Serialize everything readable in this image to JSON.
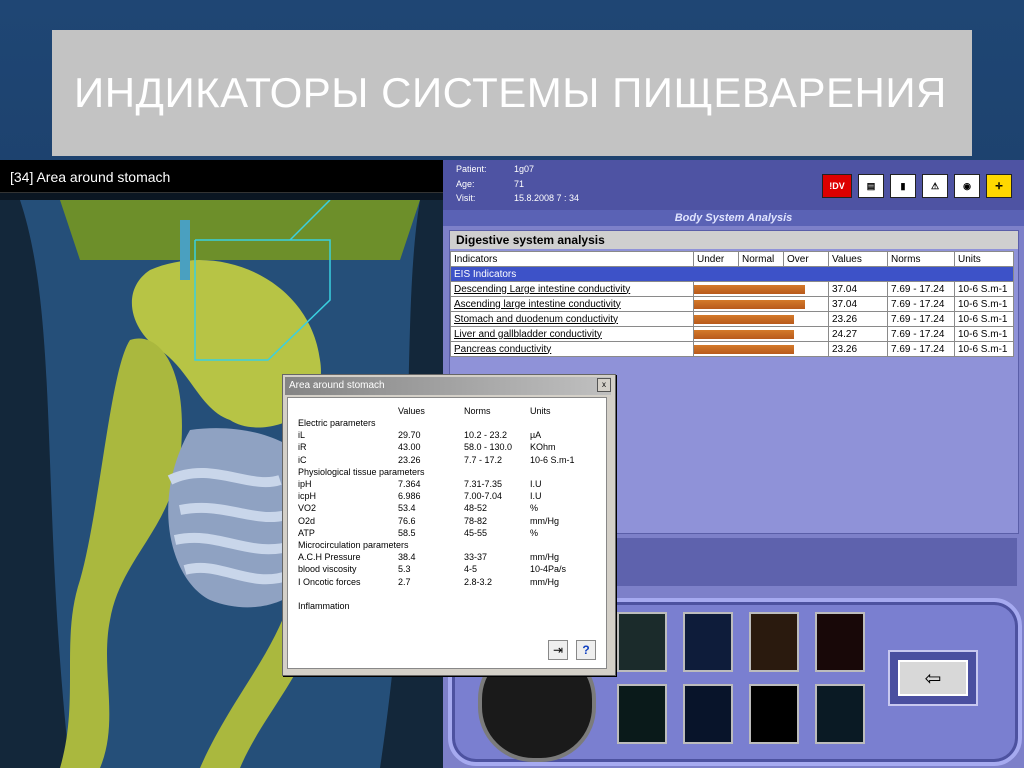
{
  "slide": {
    "title": "ИНДИКАТОРЫ СИСТЕМЫ ПИЩЕВАРЕНИЯ"
  },
  "viewport": {
    "header": "[34] Area around stomach"
  },
  "patient": {
    "patient_label": "Patient:",
    "patient_value": "1g07",
    "age_label": "Age:",
    "age_value": "71",
    "visit_label": "Visit:",
    "visit_value": "15.8.2008  7 : 34"
  },
  "toolbar": {
    "idv_label": "!DV"
  },
  "body_system": {
    "title": "Body System Analysis"
  },
  "analysis": {
    "title": "Digestive system analysis",
    "headers": {
      "indicators": "Indicators",
      "under": "Under",
      "normal": "Normal",
      "over": "Over",
      "values": "Values",
      "norms": "Norms",
      "units": "Units"
    },
    "group": "EIS  Indicators",
    "rows": [
      {
        "name": "Descending Large intestine conductivity",
        "value": "37.04",
        "norm": "7.69 - 17.24",
        "unit": "10-6 S.m-1",
        "level": 0.97
      },
      {
        "name": "Ascending large intestine  conductivity",
        "value": "37.04",
        "norm": "7.69 - 17.24",
        "unit": "10-6 S.m-1",
        "level": 0.97
      },
      {
        "name": "Stomach and duodenum conductivity",
        "value": "23.26",
        "norm": "7.69 - 17.24",
        "unit": "10-6 S.m-1",
        "level": 0.88
      },
      {
        "name": "Liver and gallbladder conductivity",
        "value": "24.27",
        "norm": "7.69 - 17.24",
        "unit": "10-6 S.m-1",
        "level": 0.88
      },
      {
        "name": "Pancreas  conductivity",
        "value": "23.26",
        "norm": "7.69 - 17.24",
        "unit": "10-6 S.m-1",
        "level": 0.88
      }
    ]
  },
  "dialog": {
    "title": "Area around stomach",
    "close": "x",
    "col_values": "Values",
    "col_norms": "Norms",
    "col_units": "Units",
    "rows": [
      {
        "name": "Electric parameters",
        "value": "",
        "norm": "",
        "unit": ""
      },
      {
        "name": "iL",
        "value": "29.70",
        "norm": "10.2 - 23.2",
        "unit": "µA"
      },
      {
        "name": "iR",
        "value": "43.00",
        "norm": "58.0 - 130.0",
        "unit": "KOhm"
      },
      {
        "name": "iC",
        "value": "23.26",
        "norm": "7.7 - 17.2",
        "unit": "10-6 S.m-1"
      },
      {
        "name": "Physiological  tissue  parameters",
        "value": "",
        "norm": "",
        "unit": ""
      },
      {
        "name": "ipH",
        "value": "7.364",
        "norm": "7.31-7.35",
        "unit": "I.U"
      },
      {
        "name": "icpH",
        "value": "6.986",
        "norm": "7.00-7.04",
        "unit": "I.U"
      },
      {
        "name": "VO2",
        "value": "53.4",
        "norm": "48-52",
        "unit": "%"
      },
      {
        "name": "O2d",
        "value": "76.6",
        "norm": "78-82",
        "unit": "mm/Hg"
      },
      {
        "name": "ATP",
        "value": "58.5",
        "norm": "45-55",
        "unit": "%"
      },
      {
        "name": "Microcirculation parameters",
        "value": "",
        "norm": "",
        "unit": ""
      },
      {
        "name": "A.C.H Pressure",
        "value": "38.4",
        "norm": "33-37",
        "unit": "mm/Hg"
      },
      {
        "name": "blood viscosity",
        "value": "5.3",
        "norm": "4-5",
        "unit": "10-4Pa/s"
      },
      {
        "name": "I Oncotic forces",
        "value": "2.7",
        "norm": "2.8-3.2",
        "unit": "mm/Hg"
      },
      {
        "name": "",
        "value": "",
        "norm": "",
        "unit": ""
      },
      {
        "name": "Inflammation",
        "value": "",
        "norm": "",
        "unit": ""
      }
    ],
    "help_icon": "?"
  },
  "console": {
    "back_label": "⇦"
  },
  "colors": {
    "bar": "#b85a1c",
    "app_bg": "#7d80c9",
    "title_bg": "#c3c3c3"
  }
}
